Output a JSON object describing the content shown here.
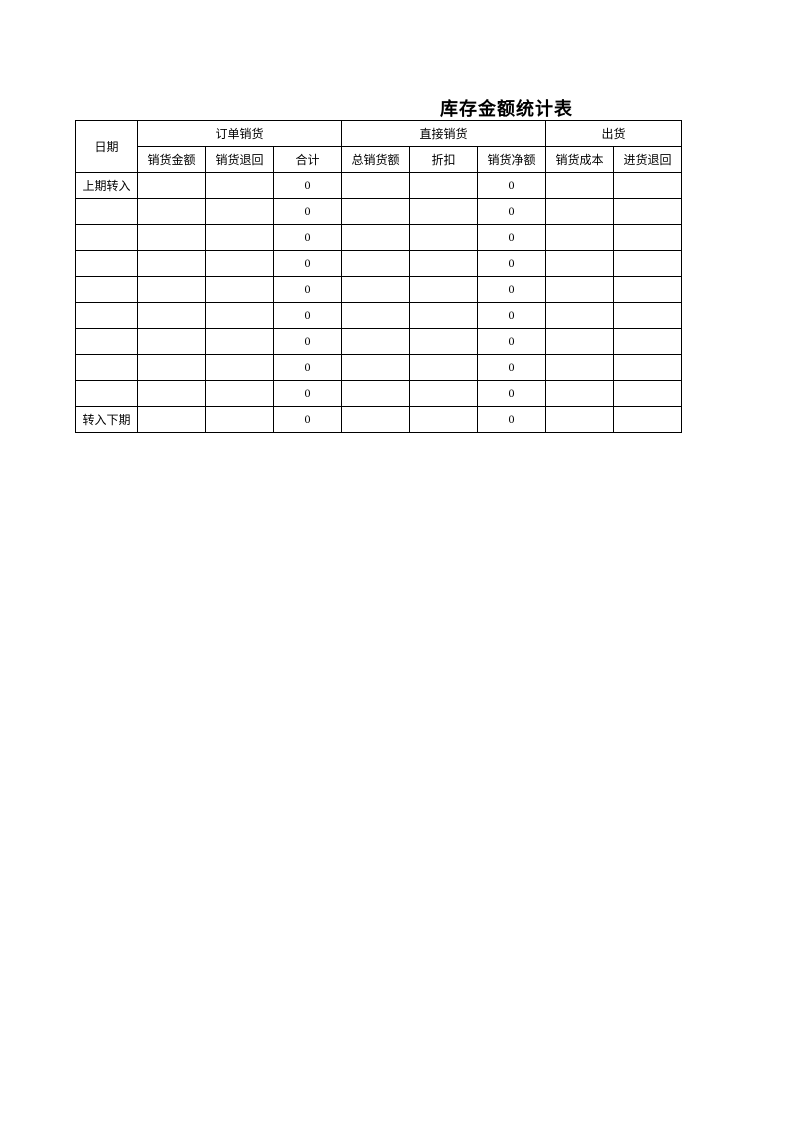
{
  "title": "库存金额统计表",
  "headers": {
    "date": "日期",
    "group1": "订单销货",
    "group2": "直接销货",
    "group3": "出货",
    "sub": {
      "salesAmount": "销货金额",
      "salesReturn": "销货退回",
      "total": "合计",
      "grossSales": "总销货额",
      "discount": "折扣",
      "netSales": "销货净额",
      "cogs": "销货成本",
      "purchaseReturn": "进货退回"
    }
  },
  "rows": [
    {
      "date": "上期转入",
      "c1": "",
      "c2": "",
      "c3": "0",
      "c4": "",
      "c5": "",
      "c6": "0",
      "c7": "",
      "c8": ""
    },
    {
      "date": "",
      "c1": "",
      "c2": "",
      "c3": "0",
      "c4": "",
      "c5": "",
      "c6": "0",
      "c7": "",
      "c8": ""
    },
    {
      "date": "",
      "c1": "",
      "c2": "",
      "c3": "0",
      "c4": "",
      "c5": "",
      "c6": "0",
      "c7": "",
      "c8": ""
    },
    {
      "date": "",
      "c1": "",
      "c2": "",
      "c3": "0",
      "c4": "",
      "c5": "",
      "c6": "0",
      "c7": "",
      "c8": ""
    },
    {
      "date": "",
      "c1": "",
      "c2": "",
      "c3": "0",
      "c4": "",
      "c5": "",
      "c6": "0",
      "c7": "",
      "c8": ""
    },
    {
      "date": "",
      "c1": "",
      "c2": "",
      "c3": "0",
      "c4": "",
      "c5": "",
      "c6": "0",
      "c7": "",
      "c8": ""
    },
    {
      "date": "",
      "c1": "",
      "c2": "",
      "c3": "0",
      "c4": "",
      "c5": "",
      "c6": "0",
      "c7": "",
      "c8": ""
    },
    {
      "date": "",
      "c1": "",
      "c2": "",
      "c3": "0",
      "c4": "",
      "c5": "",
      "c6": "0",
      "c7": "",
      "c8": ""
    },
    {
      "date": "",
      "c1": "",
      "c2": "",
      "c3": "0",
      "c4": "",
      "c5": "",
      "c6": "0",
      "c7": "",
      "c8": ""
    },
    {
      "date": "转入下期",
      "c1": "",
      "c2": "",
      "c3": "0",
      "c4": "",
      "c5": "",
      "c6": "0",
      "c7": "",
      "c8": ""
    }
  ]
}
